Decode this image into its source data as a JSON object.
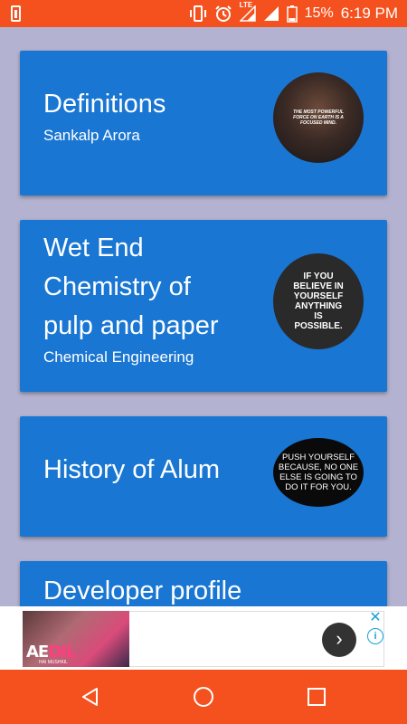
{
  "status_bar": {
    "network": "LTE",
    "battery_percent": "15%",
    "time": "6:19 PM"
  },
  "cards": [
    {
      "title_lines": [
        "Definitions"
      ],
      "subtitle": "Sankalp Arora",
      "image_text": "THE MOST POWERFUL FORCE ON EARTH IS A FOCUSED MIND."
    },
    {
      "title_lines": [
        "Wet End",
        "Chemistry of",
        "pulp and paper"
      ],
      "subtitle": "Chemical Engineering",
      "image_text": "IF YOU BELIEVE IN YOURSELF ANYTHING IS POSSIBLE."
    },
    {
      "title_lines": [
        "History of Alum"
      ],
      "subtitle": "",
      "image_text": "PUSH YOURSELF BECAUSE, NO ONE ELSE IS GOING TO DO IT FOR YOU."
    },
    {
      "title_lines": [
        "Developer profile"
      ],
      "subtitle": ""
    }
  ],
  "ad": {
    "logo_text": "AE",
    "logo_accent": "DIL",
    "logo_sub": "HAI MUSHKIL",
    "close_symbol": "✕",
    "info_symbol": "i",
    "next_symbol": "›"
  },
  "colors": {
    "accent": "#f4511e",
    "card": "#1976d2",
    "background": "#b3b3d1"
  }
}
